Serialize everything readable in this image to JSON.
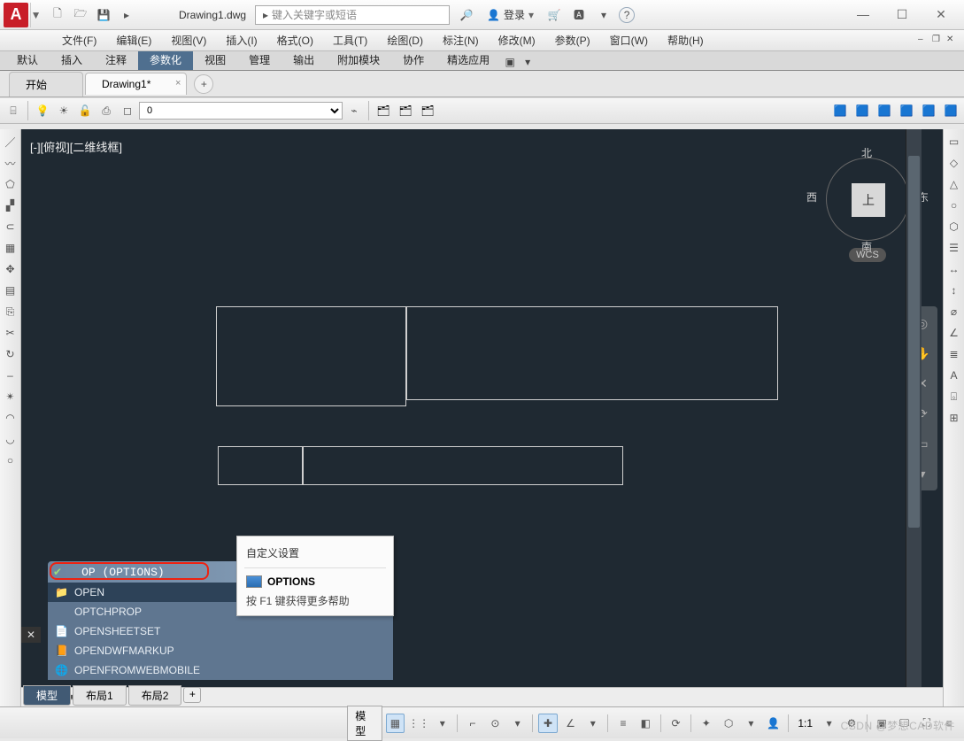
{
  "title_bar": {
    "document": "Drawing1.dwg",
    "search_placeholder": "键入关键字或短语",
    "login_label": "登录",
    "win": {
      "min": "—",
      "max": "☐",
      "close": "✕"
    }
  },
  "menus": [
    "文件(F)",
    "编辑(E)",
    "视图(V)",
    "插入(I)",
    "格式(O)",
    "工具(T)",
    "绘图(D)",
    "标注(N)",
    "修改(M)",
    "参数(P)",
    "窗口(W)",
    "帮助(H)"
  ],
  "ribbon_tabs": {
    "items": [
      "默认",
      "插入",
      "注释",
      "参数化",
      "视图",
      "管理",
      "输出",
      "附加模块",
      "协作",
      "精选应用"
    ],
    "active_index": 3
  },
  "file_tabs": {
    "items": [
      {
        "label": "开始",
        "closable": false
      },
      {
        "label": "Drawing1*",
        "closable": true
      }
    ],
    "active_index": 1
  },
  "layer": {
    "current": "0"
  },
  "canvas": {
    "view_label": "[-][俯视][二维线框]",
    "compass": {
      "n": "北",
      "s": "南",
      "e": "东",
      "w": "西",
      "face": "上",
      "wcs": "WCS"
    }
  },
  "command": {
    "typed": "OP (OPTIONS)",
    "suggestions": [
      {
        "icon": "folder",
        "text": "OPEN"
      },
      {
        "icon": "",
        "text": "OPTCHPROP"
      },
      {
        "icon": "sheet",
        "text": "OPENSHEETSET"
      },
      {
        "icon": "dwf",
        "text": "OPENDWFMARKUP"
      },
      {
        "icon": "web",
        "text": "OPENFROMWEBMOBILE"
      }
    ],
    "tooltip": {
      "head": "自定义设置",
      "main": "OPTIONS",
      "f1": "按 F1 键获得更多帮助"
    },
    "line_prefix": ">_",
    "line_text": "▾ OP"
  },
  "sheet_tabs": {
    "items": [
      "模型",
      "布局1",
      "布局2"
    ],
    "active_index": 0
  },
  "status": {
    "model_btn": "模型",
    "scale": "1:1"
  },
  "watermark": "CSDN @梦想CAD软件"
}
